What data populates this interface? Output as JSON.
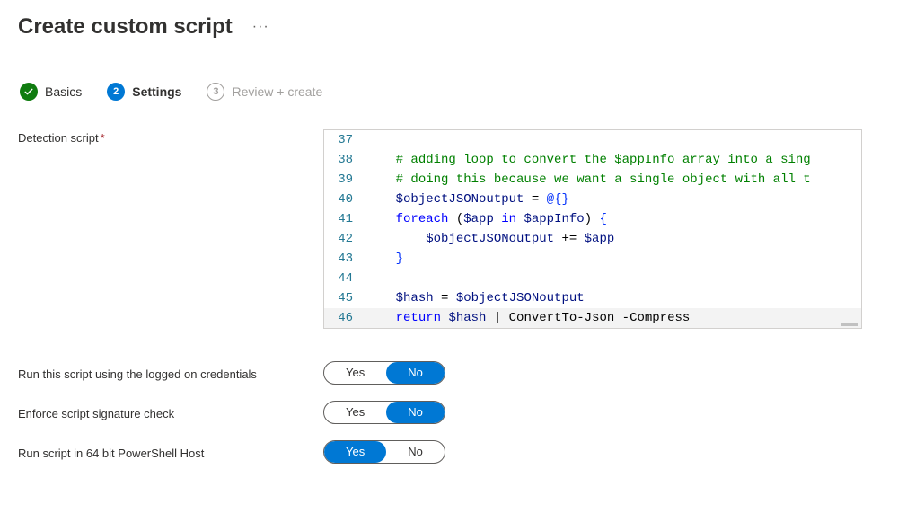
{
  "header": {
    "title": "Create custom script"
  },
  "wizard": {
    "steps": [
      {
        "label": "Basics",
        "state": "completed"
      },
      {
        "label": "Settings",
        "state": "active",
        "number": "2"
      },
      {
        "label": "Review + create",
        "state": "pending",
        "number": "3"
      }
    ]
  },
  "form": {
    "detection_script_label": "Detection script",
    "required_marker": "*",
    "run_logged_on_label": "Run this script using the logged on credentials",
    "enforce_sig_label": "Enforce script signature check",
    "run_64bit_label": "Run script in 64 bit PowerShell Host",
    "toggle_yes": "Yes",
    "toggle_no": "No"
  },
  "code": {
    "lines": [
      {
        "n": "37",
        "segments": []
      },
      {
        "n": "38",
        "segments": [
          {
            "t": "    ",
            "c": "default"
          },
          {
            "t": "# adding loop to convert the $appInfo array into a sing",
            "c": "comment"
          }
        ]
      },
      {
        "n": "39",
        "segments": [
          {
            "t": "    ",
            "c": "default"
          },
          {
            "t": "# doing this because we want a single object with all t",
            "c": "comment"
          }
        ]
      },
      {
        "n": "40",
        "segments": [
          {
            "t": "    ",
            "c": "default"
          },
          {
            "t": "$objectJSONoutput",
            "c": "variable"
          },
          {
            "t": " = ",
            "c": "operator"
          },
          {
            "t": "@{}",
            "c": "brace"
          }
        ]
      },
      {
        "n": "41",
        "segments": [
          {
            "t": "    ",
            "c": "default"
          },
          {
            "t": "foreach",
            "c": "keyword"
          },
          {
            "t": " (",
            "c": "default"
          },
          {
            "t": "$app",
            "c": "variable"
          },
          {
            "t": " ",
            "c": "default"
          },
          {
            "t": "in",
            "c": "keyword"
          },
          {
            "t": " ",
            "c": "default"
          },
          {
            "t": "$appInfo",
            "c": "variable"
          },
          {
            "t": ") ",
            "c": "default"
          },
          {
            "t": "{",
            "c": "brace"
          }
        ]
      },
      {
        "n": "42",
        "segments": [
          {
            "t": "        ",
            "c": "default"
          },
          {
            "t": "$objectJSONoutput",
            "c": "variable"
          },
          {
            "t": " += ",
            "c": "operator"
          },
          {
            "t": "$app",
            "c": "variable"
          }
        ]
      },
      {
        "n": "43",
        "segments": [
          {
            "t": "    ",
            "c": "default"
          },
          {
            "t": "}",
            "c": "brace"
          }
        ]
      },
      {
        "n": "44",
        "segments": []
      },
      {
        "n": "45",
        "segments": [
          {
            "t": "    ",
            "c": "default"
          },
          {
            "t": "$hash",
            "c": "variable"
          },
          {
            "t": " = ",
            "c": "operator"
          },
          {
            "t": "$objectJSONoutput",
            "c": "variable"
          }
        ]
      },
      {
        "n": "46",
        "segments": [
          {
            "t": "    ",
            "c": "default"
          },
          {
            "t": "return",
            "c": "keyword"
          },
          {
            "t": " ",
            "c": "default"
          },
          {
            "t": "$hash",
            "c": "variable"
          },
          {
            "t": " | ConvertTo-Json -Compress",
            "c": "default"
          }
        ],
        "cursor": true
      }
    ]
  },
  "toggles": {
    "run_logged_on": "No",
    "enforce_sig": "No",
    "run_64bit": "Yes"
  }
}
